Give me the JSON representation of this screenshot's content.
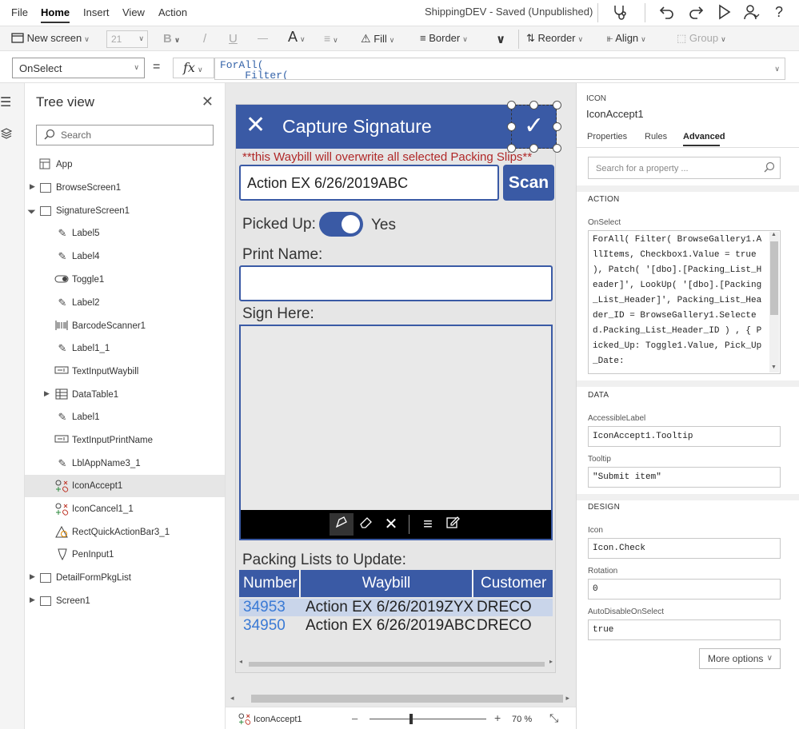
{
  "menu": {
    "file": "File",
    "home": "Home",
    "insert": "Insert",
    "view": "View",
    "action": "Action"
  },
  "document_title": "ShippingDEV - Saved (Unpublished)",
  "ribbon": {
    "new_screen": "New screen",
    "font_size": "21",
    "bold": "B",
    "italic": "/",
    "underline": "U",
    "strike": "—",
    "font_color": "A",
    "fill": "Fill",
    "border": "Border",
    "reorder": "Reorder",
    "align": "Align",
    "group": "Group"
  },
  "formula_bar": {
    "property": "OnSelect",
    "equals": "=",
    "fx": "fx",
    "formula_line1": "ForAll(",
    "formula_line2": "    Filter("
  },
  "tree": {
    "title": "Tree view",
    "search_placeholder": "Search",
    "items": [
      {
        "label": "App",
        "icon": "app-icon"
      },
      {
        "label": "BrowseScreen1",
        "icon": "screen-icon"
      },
      {
        "label": "SignatureScreen1",
        "icon": "screen-icon"
      },
      {
        "label": "Label5",
        "icon": "label-icon"
      },
      {
        "label": "Label4",
        "icon": "label-icon"
      },
      {
        "label": "Toggle1",
        "icon": "toggle-icon"
      },
      {
        "label": "Label2",
        "icon": "label-icon"
      },
      {
        "label": "BarcodeScanner1",
        "icon": "barcode-icon"
      },
      {
        "label": "Label1_1",
        "icon": "label-icon"
      },
      {
        "label": "TextInputWaybill",
        "icon": "textinput-icon"
      },
      {
        "label": "DataTable1",
        "icon": "table-icon"
      },
      {
        "label": "Label1",
        "icon": "label-icon"
      },
      {
        "label": "TextInputPrintName",
        "icon": "textinput-icon"
      },
      {
        "label": "LblAppName3_1",
        "icon": "label-icon"
      },
      {
        "label": "IconAccept1",
        "icon": "icons-icon"
      },
      {
        "label": "IconCancel1_1",
        "icon": "icons-icon"
      },
      {
        "label": "RectQuickActionBar3_1",
        "icon": "shape-icon"
      },
      {
        "label": "PenInput1",
        "icon": "pen-icon"
      },
      {
        "label": "DetailFormPkgList",
        "icon": "screen-icon"
      },
      {
        "label": "Screen1",
        "icon": "screen-icon"
      }
    ]
  },
  "app_screen": {
    "header_title": "Capture Signature",
    "warning": "**this Waybill will overwrite all selected Packing Slips**",
    "waybill_value": "Action EX 6/26/2019ABC",
    "scan_label": "Scan",
    "picked_up_label": "Picked Up:",
    "toggle_on": true,
    "yes_label": "Yes",
    "print_name_label": "Print Name:",
    "print_name_value": "",
    "sign_here_label": "Sign Here:",
    "packing_lists_label": "Packing Lists to Update:",
    "table": {
      "headers": [
        "Number",
        "Waybill",
        "Customer"
      ],
      "rows": [
        [
          "34953",
          "Action EX 6/26/2019ZYX",
          "DRECO"
        ],
        [
          "34950",
          "Action EX 6/26/2019ABC",
          "DRECO"
        ]
      ]
    }
  },
  "status": {
    "selected": "IconAccept1",
    "zoom_minus": "–",
    "zoom_plus": "+",
    "zoom": "70",
    "zoom_unit": "%"
  },
  "props": {
    "type": "ICON",
    "name": "IconAccept1",
    "tabs": [
      "Properties",
      "Rules",
      "Advanced"
    ],
    "active_tab": "Advanced",
    "search_placeholder": "Search for a property ...",
    "action_section": "ACTION",
    "onselect_label": "OnSelect",
    "onselect_value": "ForAll( Filter( BrowseGallery1.AllItems, Checkbox1.Value = true ), Patch( '[dbo].[Packing_List_Header]', LookUp( '[dbo].[Packing_List_Header]', Packing_List_Header_ID = BrowseGallery1.Selected.Packing_List_Header_ID ) , { Picked_Up: Toggle1.Value, Pick_Up_Date:",
    "data_section": "DATA",
    "accessible_label": "AccessibleLabel",
    "accessible_value": "IconAccept1.Tooltip",
    "tooltip_label": "Tooltip",
    "tooltip_value": "\"Submit item\"",
    "design_section": "DESIGN",
    "icon_label": "Icon",
    "icon_value": "Icon.Check",
    "rotation_label": "Rotation",
    "rotation_value": "0",
    "autodisable_label": "AutoDisableOnSelect",
    "autodisable_value": "true",
    "more_options": "More options"
  },
  "colors": {
    "brand": "#3a5aa5",
    "warning": "#b02828",
    "link": "#3a7ad5",
    "row_highlight": "#c9d5ea"
  }
}
